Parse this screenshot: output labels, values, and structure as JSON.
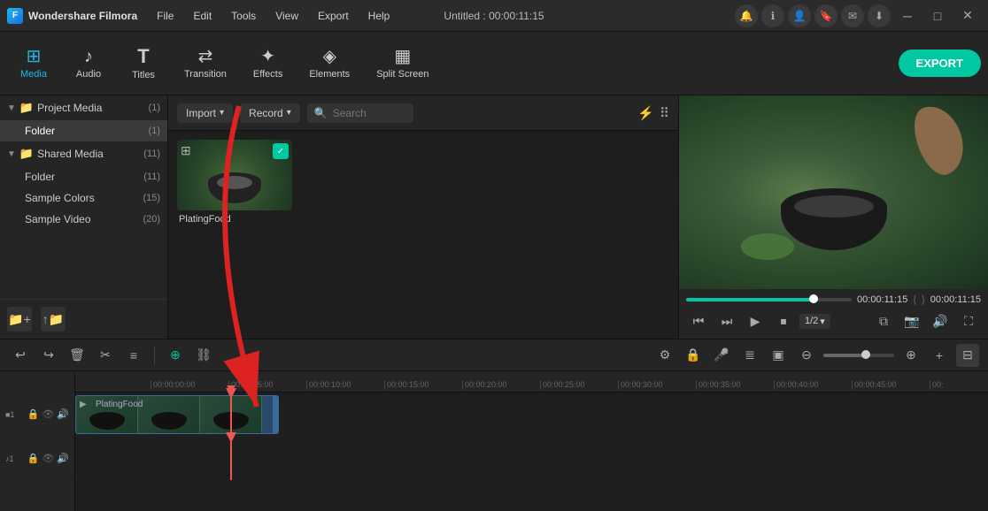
{
  "app": {
    "name": "Wondershare Filmora",
    "logo_letter": "F",
    "title": "Untitled : 00:00:11:15"
  },
  "titlebar": {
    "menu": [
      "File",
      "Edit",
      "Tools",
      "View",
      "Export",
      "Help"
    ],
    "sys_icons": [
      "notification",
      "info",
      "user",
      "bookmark",
      "mail",
      "download"
    ],
    "win_controls": [
      "minimize",
      "maximize",
      "close"
    ]
  },
  "toolbar": {
    "tabs": [
      {
        "id": "media",
        "label": "Media",
        "icon": "⊞",
        "active": true
      },
      {
        "id": "audio",
        "label": "Audio",
        "icon": "♪",
        "active": false
      },
      {
        "id": "titles",
        "label": "Titles",
        "icon": "T",
        "active": false
      },
      {
        "id": "transition",
        "label": "Transition",
        "icon": "↔",
        "active": false
      },
      {
        "id": "effects",
        "label": "Effects",
        "icon": "✦",
        "active": false
      },
      {
        "id": "elements",
        "label": "Elements",
        "icon": "◈",
        "active": false
      },
      {
        "id": "splitscreen",
        "label": "Split Screen",
        "icon": "▦",
        "active": false
      }
    ],
    "export_label": "EXPORT"
  },
  "sidebar": {
    "sections": [
      {
        "id": "project-media",
        "label": "Project Media",
        "count": 1,
        "expanded": true,
        "children": [
          {
            "id": "folder",
            "label": "Folder",
            "count": 1,
            "active": true
          }
        ]
      },
      {
        "id": "shared-media",
        "label": "Shared Media",
        "count": 11,
        "expanded": true,
        "children": [
          {
            "id": "shared-folder",
            "label": "Folder",
            "count": 11,
            "active": false
          }
        ]
      }
    ],
    "items": [
      {
        "id": "sample-colors",
        "label": "Sample Colors",
        "count": 15
      },
      {
        "id": "sample-video",
        "label": "Sample Video",
        "count": 20
      }
    ],
    "bottom_btns": [
      "new-folder",
      "import-folder"
    ]
  },
  "media_panel": {
    "import_label": "Import",
    "record_label": "Record",
    "search_placeholder": "Search",
    "items": [
      {
        "id": "plating-food",
        "label": "PlatingFood",
        "checked": true
      }
    ]
  },
  "preview": {
    "time": "00:00:11:15",
    "progress_pct": 77,
    "speed": "1/2",
    "controls": [
      "skip-back",
      "step-back",
      "play",
      "stop",
      "speed",
      "pip",
      "snapshot",
      "volume",
      "fullscreen"
    ]
  },
  "timeline": {
    "toolbar_btns": [
      "undo",
      "redo",
      "delete",
      "cut",
      "settings"
    ],
    "track_btns": [
      "magnet",
      "link"
    ],
    "right_btns": [
      "ripple",
      "lock",
      "mic",
      "caption",
      "pip2",
      "zoom-out",
      "zoom-in",
      "add-track"
    ],
    "rulers": [
      "00:00:00:00",
      "00:00:05:00",
      "00:00:10:00",
      "00:00:15:00",
      "00:00:20:00",
      "00:00:25:00",
      "00:00:30:00",
      "00:00:35:00",
      "00:00:40:00",
      "00:00:45:00",
      "00:"
    ],
    "tracks": [
      {
        "type": "video",
        "number": 1,
        "icons": [
          "lock",
          "eye",
          "speaker"
        ],
        "clip_label": "PlatingFood"
      }
    ]
  }
}
